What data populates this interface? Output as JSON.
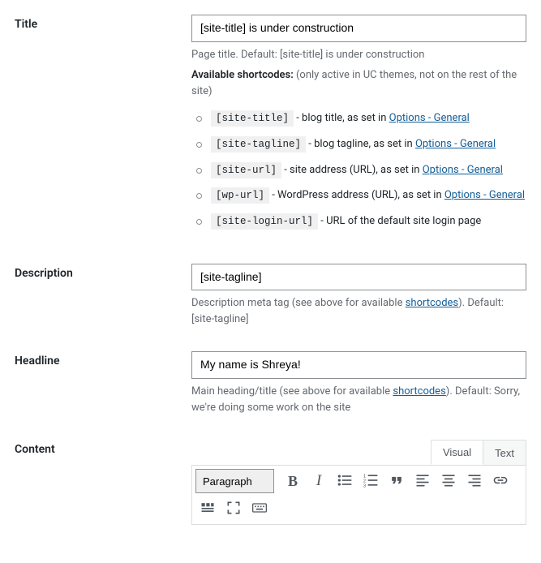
{
  "title": {
    "label": "Title",
    "value": "[site-title] is under construction",
    "help_prefix": "Page title. Default: [site-title] is under construction",
    "available_label": "Available shortcodes:",
    "available_note": " (only active in UC themes, not on the rest of the site)",
    "shortcodes": [
      {
        "code": "[site-title]",
        "desc": " - blog title, as set in ",
        "link": "Options - General"
      },
      {
        "code": "[site-tagline]",
        "desc": " - blog tagline, as set in ",
        "link": "Options - General"
      },
      {
        "code": "[site-url]",
        "desc": " - site address (URL), as set in ",
        "link": "Options - General"
      },
      {
        "code": "[wp-url]",
        "desc": " - WordPress address (URL), as set in ",
        "link": "Options - General"
      },
      {
        "code": "[site-login-url]",
        "desc": " - URL of the default site login page",
        "link": ""
      }
    ]
  },
  "description": {
    "label": "Description",
    "value": "[site-tagline]",
    "help_before": "Description meta tag (see above for available ",
    "help_link": "shortcodes",
    "help_after": "). Default: [site-tagline]"
  },
  "headline": {
    "label": "Headline",
    "value": "My name is Shreya!",
    "help_before": "Main heading/title (see above for available ",
    "help_link": "shortcodes",
    "help_after": "). Default: Sorry, we're doing some work on the site"
  },
  "content": {
    "label": "Content",
    "tabs": {
      "visual": "Visual",
      "text": "Text"
    },
    "format_select": "Paragraph"
  }
}
